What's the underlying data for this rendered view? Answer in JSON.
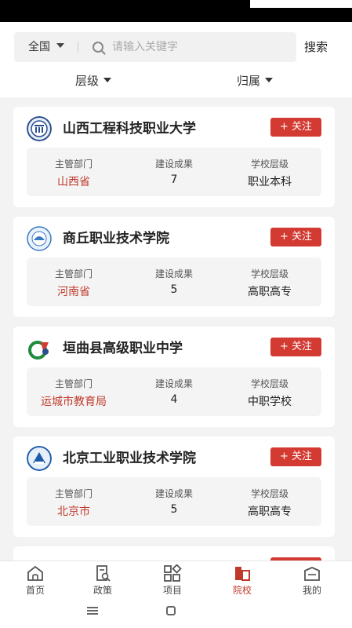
{
  "search": {
    "region": "全国",
    "placeholder": "请输入关键字",
    "button": "搜索"
  },
  "filters": [
    {
      "label": "层级"
    },
    {
      "label": "归属"
    }
  ],
  "stat_labels": {
    "dept": "主管部门",
    "result": "建设成果",
    "level": "学校层级"
  },
  "schools": [
    {
      "name": "山西工程科技职业大学",
      "follow": "+ 关注",
      "dept": "山西省",
      "result": "7",
      "level": "职业本科",
      "logo_icon": "school-seal-icon"
    },
    {
      "name": "商丘职业技术学院",
      "follow": "+ 关注",
      "dept": "河南省",
      "result": "5",
      "level": "高职高专",
      "logo_icon": "school-seal-icon"
    },
    {
      "name": "垣曲县高级职业中学",
      "follow": "+ 关注",
      "dept": "运城市教育局",
      "result": "4",
      "level": "中职学校",
      "logo_icon": "school-emblem-icon"
    },
    {
      "name": "北京工业职业技术学院",
      "follow": "+ 关注",
      "dept": "北京市",
      "result": "5",
      "level": "高职高专",
      "logo_icon": "school-seal-icon"
    }
  ],
  "tabs": [
    {
      "label": "首页",
      "icon": "home-icon"
    },
    {
      "label": "政策",
      "icon": "policy-icon"
    },
    {
      "label": "项目",
      "icon": "grid-icon"
    },
    {
      "label": "院校",
      "icon": "school-icon",
      "active": true
    },
    {
      "label": "我的",
      "icon": "profile-icon"
    }
  ],
  "colors": {
    "accent": "#d23a32",
    "accent_text": "#c0392b",
    "list_bg": "#f3f3f3"
  }
}
